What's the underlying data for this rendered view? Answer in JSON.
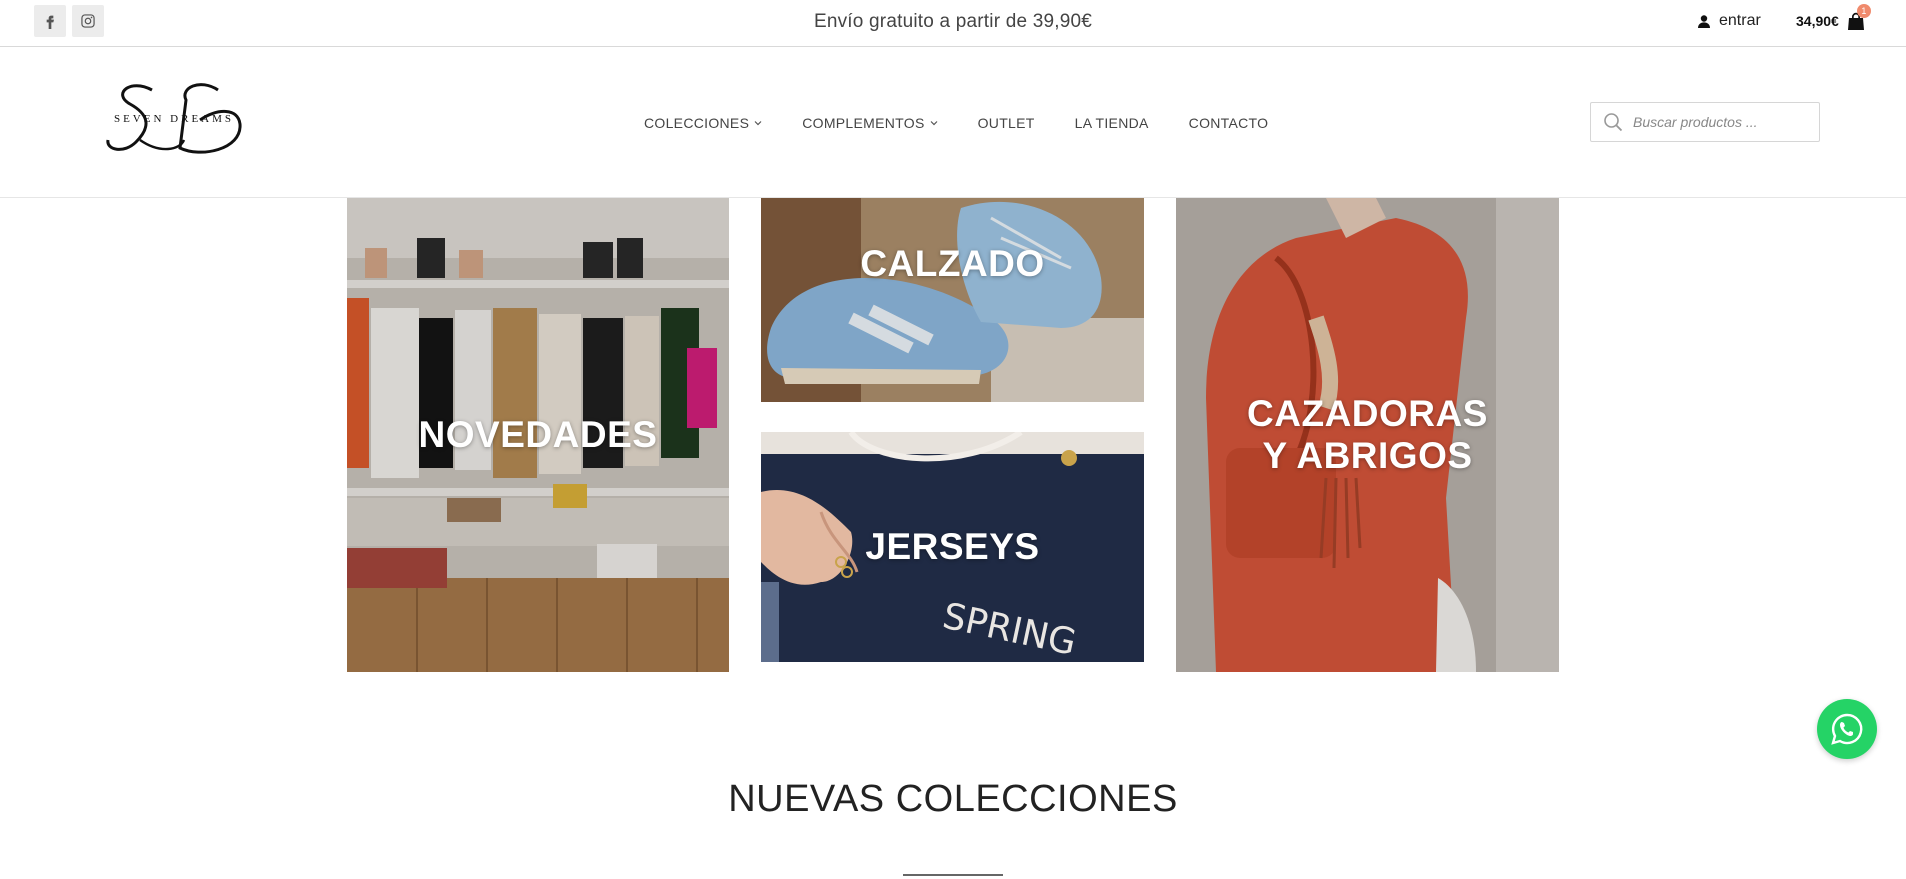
{
  "topbar": {
    "social": [
      {
        "name": "facebook-icon"
      },
      {
        "name": "instagram-icon"
      }
    ],
    "promo_text": "Envío gratuito a partir de 39,90€",
    "login_label": "entrar",
    "cart_total": "34,90€",
    "cart_count": "1"
  },
  "header": {
    "logo_text": "SEVEN DREAMS",
    "nav": [
      {
        "label": "COLECCIONES",
        "has_dropdown": true
      },
      {
        "label": "COMPLEMENTOS",
        "has_dropdown": true
      },
      {
        "label": "OUTLET",
        "has_dropdown": false
      },
      {
        "label": "LA TIENDA",
        "has_dropdown": false
      },
      {
        "label": "CONTACTO",
        "has_dropdown": false
      }
    ],
    "search_placeholder": "Buscar productos ..."
  },
  "categories": [
    {
      "label": "NOVEDADES"
    },
    {
      "label": "CALZADO"
    },
    {
      "label": "JERSEYS"
    },
    {
      "label": "CAZADORAS Y ABRIGOS"
    }
  ],
  "section": {
    "title": "NUEVAS COLECCIONES"
  },
  "colors": {
    "accent_badge": "#f08a6c",
    "whatsapp": "#25d366"
  }
}
